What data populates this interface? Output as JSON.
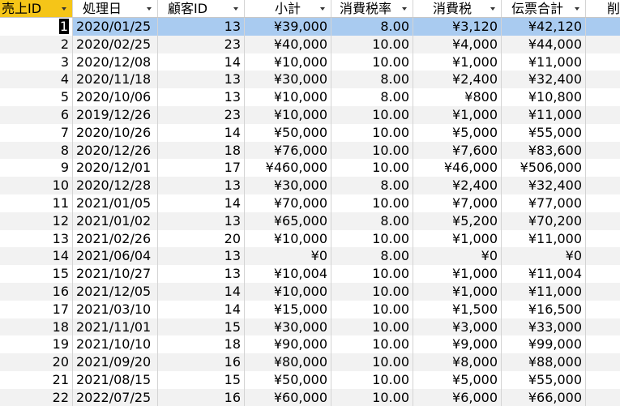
{
  "table": {
    "columns": [
      "売上ID",
      "処理日",
      "顧客ID",
      "小計",
      "消費税率",
      "消費税",
      "伝票合計",
      "削"
    ],
    "selected_row_index": 0,
    "rows": [
      [
        "1",
        "2020/01/25",
        "13",
        "¥39,000",
        "8.00",
        "¥3,120",
        "¥42,120",
        ""
      ],
      [
        "2",
        "2020/02/25",
        "23",
        "¥40,000",
        "10.00",
        "¥4,000",
        "¥44,000",
        ""
      ],
      [
        "3",
        "2020/12/08",
        "14",
        "¥10,000",
        "10.00",
        "¥1,000",
        "¥11,000",
        ""
      ],
      [
        "4",
        "2020/11/18",
        "13",
        "¥30,000",
        "8.00",
        "¥2,400",
        "¥32,400",
        ""
      ],
      [
        "5",
        "2020/10/06",
        "13",
        "¥10,000",
        "8.00",
        "¥800",
        "¥10,800",
        ""
      ],
      [
        "6",
        "2019/12/26",
        "23",
        "¥10,000",
        "10.00",
        "¥1,000",
        "¥11,000",
        ""
      ],
      [
        "7",
        "2020/10/26",
        "14",
        "¥50,000",
        "10.00",
        "¥5,000",
        "¥55,000",
        ""
      ],
      [
        "8",
        "2020/12/26",
        "18",
        "¥76,000",
        "10.00",
        "¥7,600",
        "¥83,600",
        ""
      ],
      [
        "9",
        "2020/12/01",
        "17",
        "¥460,000",
        "10.00",
        "¥46,000",
        "¥506,000",
        ""
      ],
      [
        "10",
        "2020/12/28",
        "13",
        "¥30,000",
        "8.00",
        "¥2,400",
        "¥32,400",
        ""
      ],
      [
        "11",
        "2021/01/05",
        "14",
        "¥70,000",
        "10.00",
        "¥7,000",
        "¥77,000",
        ""
      ],
      [
        "12",
        "2021/01/02",
        "13",
        "¥65,000",
        "8.00",
        "¥5,200",
        "¥70,200",
        ""
      ],
      [
        "13",
        "2021/02/26",
        "20",
        "¥10,000",
        "10.00",
        "¥1,000",
        "¥11,000",
        ""
      ],
      [
        "14",
        "2021/06/04",
        "13",
        "¥0",
        "8.00",
        "¥0",
        "¥0",
        ""
      ],
      [
        "15",
        "2021/10/27",
        "13",
        "¥10,004",
        "10.00",
        "¥1,000",
        "¥11,004",
        ""
      ],
      [
        "16",
        "2021/12/05",
        "14",
        "¥10,000",
        "10.00",
        "¥1,000",
        "¥11,000",
        ""
      ],
      [
        "17",
        "2021/03/10",
        "14",
        "¥15,000",
        "10.00",
        "¥1,500",
        "¥16,500",
        ""
      ],
      [
        "18",
        "2021/11/01",
        "15",
        "¥30,000",
        "10.00",
        "¥3,000",
        "¥33,000",
        ""
      ],
      [
        "19",
        "2021/10/10",
        "18",
        "¥90,000",
        "10.00",
        "¥9,000",
        "¥99,000",
        ""
      ],
      [
        "20",
        "2021/09/20",
        "16",
        "¥80,000",
        "10.00",
        "¥8,000",
        "¥88,000",
        ""
      ],
      [
        "21",
        "2021/08/15",
        "15",
        "¥50,000",
        "10.00",
        "¥5,000",
        "¥55,000",
        ""
      ],
      [
        "22",
        "2022/07/25",
        "16",
        "¥60,000",
        "10.00",
        "¥6,000",
        "¥66,000",
        ""
      ]
    ]
  },
  "colors": {
    "selected_header": "#f5c518",
    "selected_row": "#a9cbf0",
    "alt_row": "#f2f2f2"
  }
}
